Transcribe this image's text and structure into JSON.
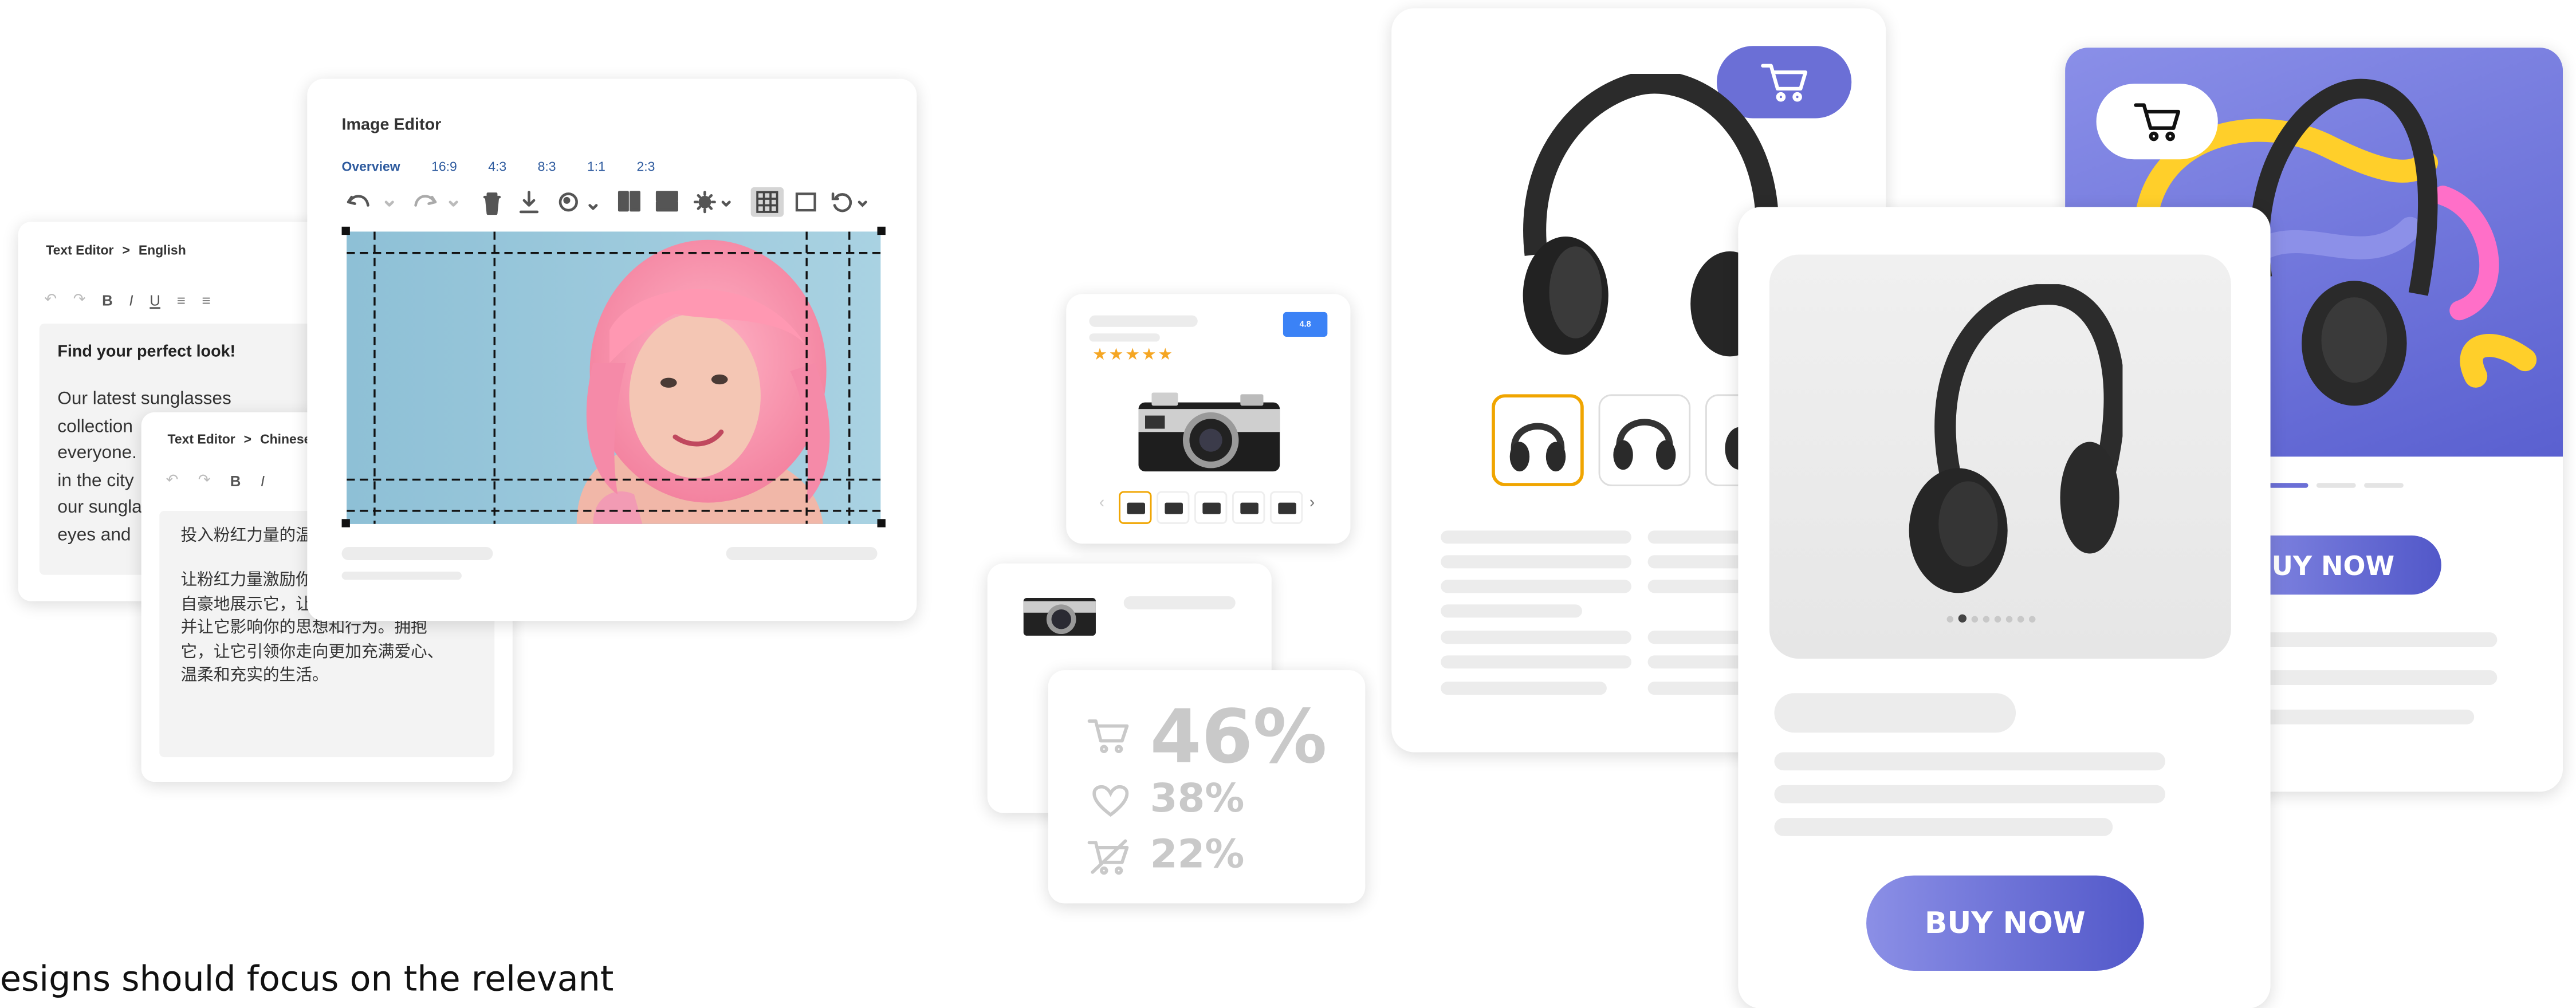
{
  "colors": {
    "accent": "#6b6fd6",
    "buy_gradient_start": "#8b8fe6",
    "buy_gradient_end": "#5258c9",
    "star": "#f5a623",
    "badge": "#3b82f6"
  },
  "text_editor_en": {
    "breadcrumb_root": "Text Editor",
    "breadcrumb_sep": ">",
    "breadcrumb_lang": "English",
    "tools": [
      "↶",
      "↷",
      "B",
      "I",
      "U",
      "≡",
      "≡"
    ],
    "heading": "Find your perfect look!",
    "body_lines": [
      "Our latest sunglasses",
      "collection",
      "everyone.",
      "in the city",
      "our sungla",
      "eyes and"
    ]
  },
  "text_editor_cn": {
    "breadcrumb_root": "Text Editor",
    "breadcrumb_sep": ">",
    "breadcrumb_lang": "Chinese",
    "tools": [
      "↶",
      "↷",
      "B",
      "I"
    ],
    "heading": "投入粉红力量的温",
    "body_lines": [
      "让粉红力量激励你",
      "自豪地展示它，让",
      "并让它影响你的思想和行为。拥抱",
      "它，让它引领你走向更加充满爱心、",
      "温柔和充实的生活。"
    ]
  },
  "image_editor": {
    "title": "Image Editor",
    "tabs": [
      "Overview",
      "16:9",
      "4:3",
      "8:3",
      "1:1",
      "2:3"
    ],
    "active_tab": "Overview"
  },
  "small_product": {
    "badge": "4.8",
    "stars": "★★★★★",
    "prev": "‹",
    "next": "›"
  },
  "stats": [
    {
      "icon": "cart-icon",
      "value": "46%"
    },
    {
      "icon": "heart-icon",
      "value": "38%"
    },
    {
      "icon": "cart-off-icon",
      "value": "22%"
    }
  ],
  "product_center": {
    "buy_label": "BUY NOW"
  },
  "product_right": {
    "buy_label": "BUY NOW"
  },
  "caption": "esigns should focus on the relevant"
}
